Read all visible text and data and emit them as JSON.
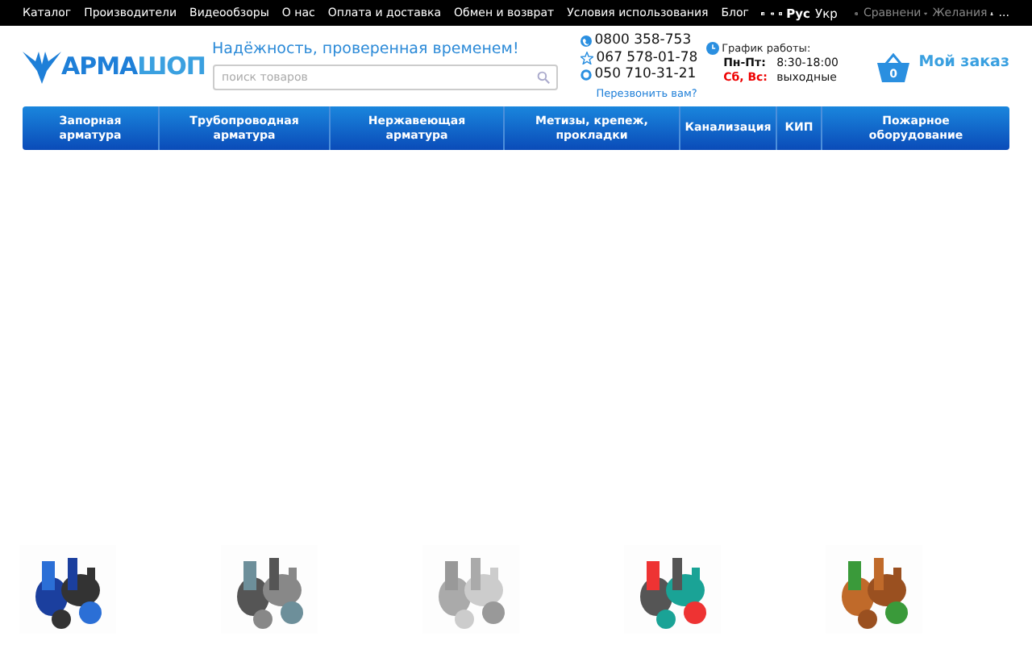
{
  "top_menu": [
    "Каталог",
    "Производители",
    "Видеообзоры",
    "О нас",
    "Оплата и доставка",
    "Обмен и возврат",
    "Условия использования",
    "Блог"
  ],
  "languages": [
    {
      "label": "Рус",
      "selected": true
    },
    {
      "label": "Укр",
      "selected": false
    }
  ],
  "compare": {
    "label": "Сравнени",
    "disabled": true
  },
  "wishlist": {
    "label": "Желания",
    "disabled": true
  },
  "account": {
    "label": "..."
  },
  "logo": {
    "text_a": "АРМА",
    "text_b": "ШОП"
  },
  "slogan": "Надёжность, проверенная временем!",
  "search": {
    "placeholder": "поиск товаров"
  },
  "phones": [
    {
      "number": "0800 358-753",
      "kind": "phone"
    },
    {
      "number": "067 578-01-78",
      "kind": "star"
    },
    {
      "number": "050 710-31-21",
      "kind": "ring"
    }
  ],
  "callback": "Перезвонить вам?",
  "schedule": {
    "title": "График работы:",
    "rows": [
      {
        "days": "Пн-Пт:",
        "hours": "8:30-18:00",
        "weekend": false
      },
      {
        "days": "Сб, Вс:",
        "hours": "выходные",
        "weekend": true
      }
    ]
  },
  "cart": {
    "count": "0",
    "label": "Мой заказ"
  },
  "nav": [
    "Запорная арматура",
    "Трубопроводная арматура",
    "Нержавеющая арматура",
    "Метизы, крепеж, прокладки",
    "Канализация",
    "КИП",
    "Пожарное оборудование"
  ],
  "products": [
    {
      "kind": "picture"
    },
    {
      "kind": "picture"
    },
    {
      "kind": "picture"
    },
    {
      "kind": "picture"
    },
    {
      "kind": "picture"
    }
  ]
}
